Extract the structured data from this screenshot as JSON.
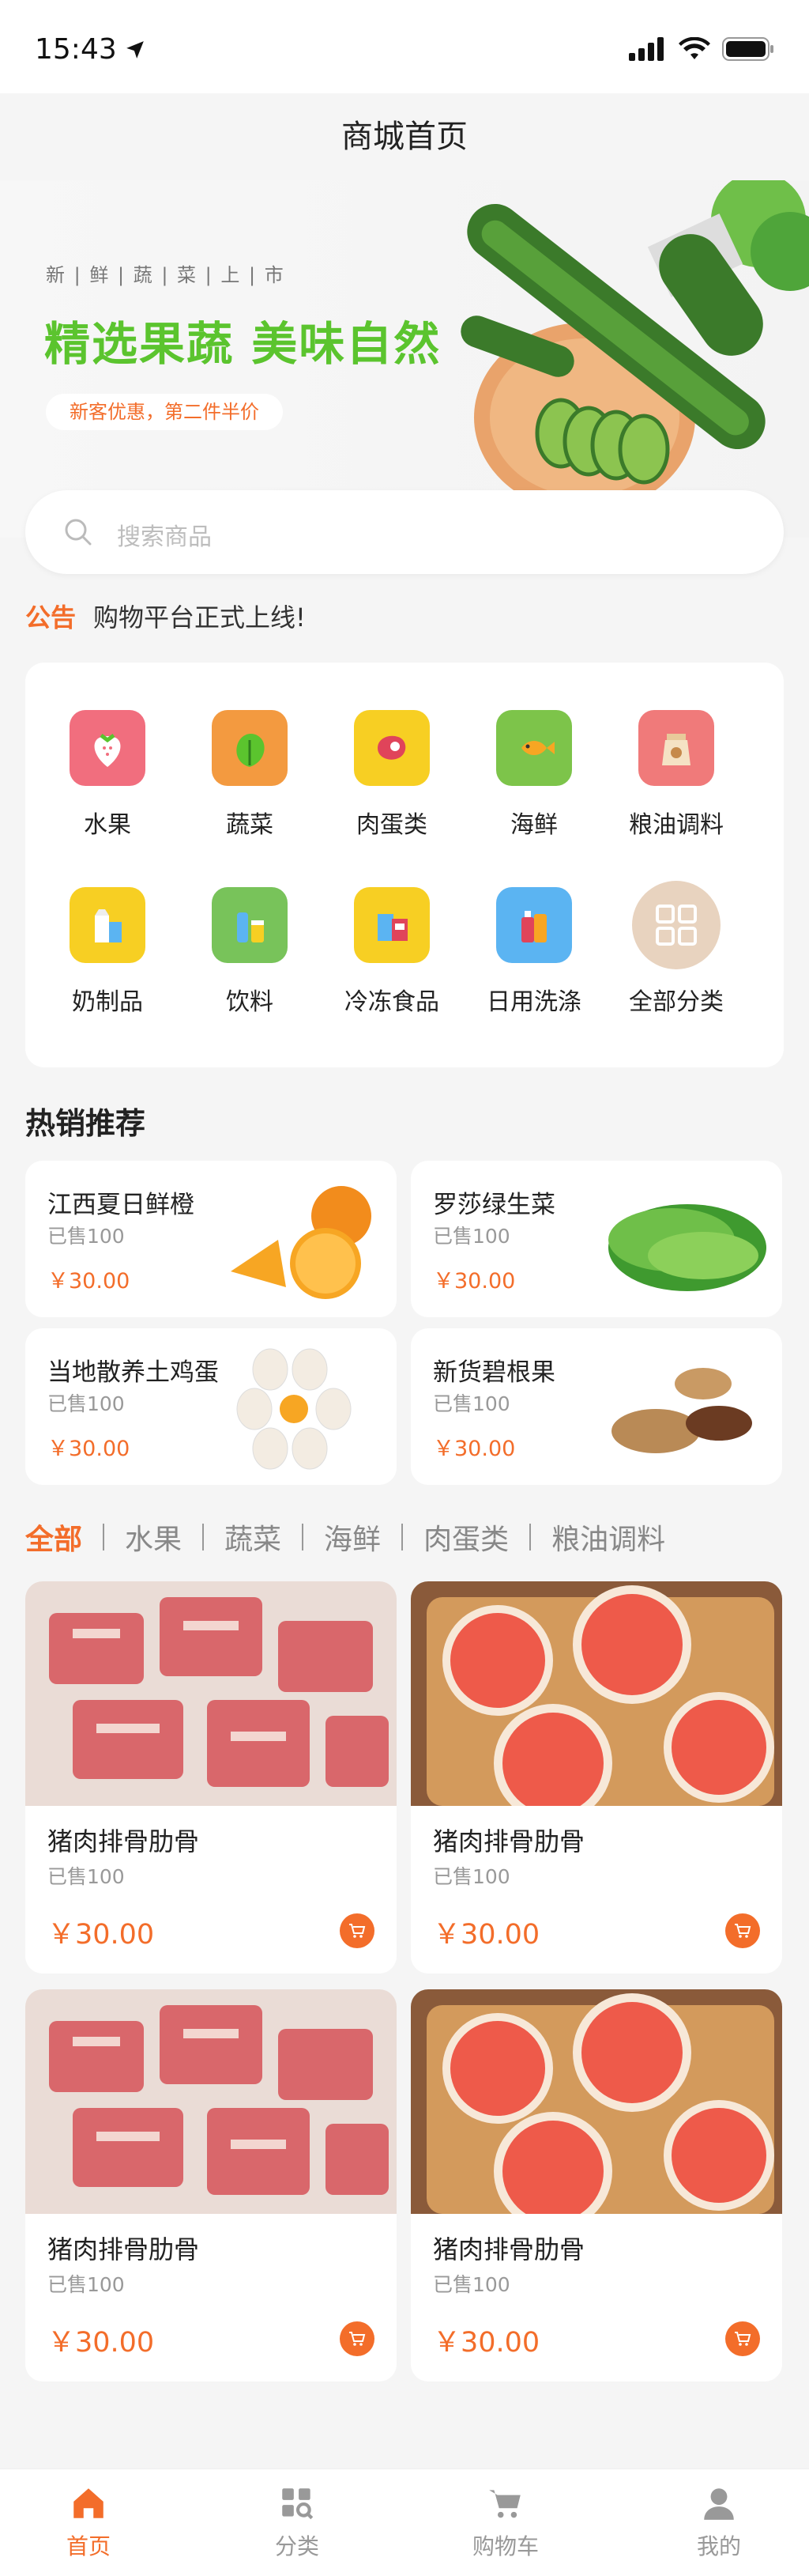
{
  "status": {
    "time": "15:43"
  },
  "header": {
    "title": "商城首页"
  },
  "banner": {
    "subtitle": "新 | 鲜 | 蔬 | 菜 | 上 | 市",
    "title": "精选果蔬  美味自然",
    "promo": "新客优惠，第二件半价"
  },
  "search": {
    "placeholder": "搜索商品"
  },
  "notice": {
    "tag": "公告",
    "text": "购物平台正式上线!"
  },
  "categories": [
    {
      "label": "水果",
      "icon": "strawberry-icon",
      "color": "#f16e7e"
    },
    {
      "label": "蔬菜",
      "icon": "lettuce-icon",
      "color": "#f39a40"
    },
    {
      "label": "肉蛋类",
      "icon": "meat-icon",
      "color": "#f7cf23"
    },
    {
      "label": "海鲜",
      "icon": "fish-icon",
      "color": "#7dc44a"
    },
    {
      "label": "粮油调料",
      "icon": "rice-bag-icon",
      "color": "#f07a7a"
    },
    {
      "label": "奶制品",
      "icon": "milk-icon",
      "color": "#f7cf23"
    },
    {
      "label": "饮料",
      "icon": "drink-icon",
      "color": "#78c35a"
    },
    {
      "label": "冷冻食品",
      "icon": "frozen-food-icon",
      "color": "#f7cf23"
    },
    {
      "label": "日用洗涤",
      "icon": "detergent-icon",
      "color": "#5bb4f2"
    },
    {
      "label": "全部分类",
      "icon": "grid-icon",
      "color": "#e8d3bf"
    }
  ],
  "hot": {
    "title": "热销推荐",
    "items": [
      {
        "name": "江西夏日鲜橙",
        "sold": "已售100",
        "price": "￥30.00"
      },
      {
        "name": "罗莎绿生菜",
        "sold": "已售100",
        "price": "￥30.00"
      },
      {
        "name": "当地散养土鸡蛋",
        "sold": "已售100",
        "price": "￥30.00"
      },
      {
        "name": "新货碧根果",
        "sold": "已售100",
        "price": "￥30.00"
      }
    ]
  },
  "tabs": [
    "全部",
    "水果",
    "蔬菜",
    "海鲜",
    "肉蛋类",
    "粮油调料"
  ],
  "products": [
    {
      "name": "猪肉排骨肋骨",
      "sold": "已售100",
      "price": "￥30.00"
    },
    {
      "name": "猪肉排骨肋骨",
      "sold": "已售100",
      "price": "￥30.00"
    },
    {
      "name": "猪肉排骨肋骨",
      "sold": "已售100",
      "price": "￥30.00"
    },
    {
      "name": "猪肉排骨肋骨",
      "sold": "已售100",
      "price": "￥30.00"
    }
  ],
  "tabbar": [
    {
      "label": "首页",
      "icon": "home-icon"
    },
    {
      "label": "分类",
      "icon": "category-icon"
    },
    {
      "label": "购物车",
      "icon": "cart-icon"
    },
    {
      "label": "我的",
      "icon": "user-icon"
    }
  ],
  "colors": {
    "accent": "#f36d2a",
    "brand_green": "#5bc42e"
  }
}
